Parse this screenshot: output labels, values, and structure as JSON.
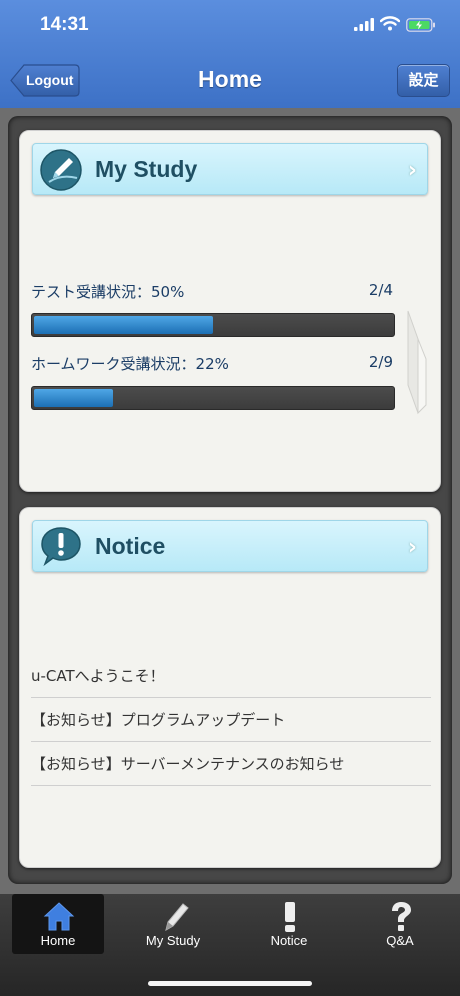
{
  "status_bar": {
    "time": "14:31"
  },
  "nav": {
    "title": "Home",
    "logout_label": "Logout",
    "settings_label": "設定"
  },
  "study_card": {
    "title": "My Study",
    "icon": "pencil-badge-icon",
    "progress": [
      {
        "label": "テスト受講状況：50%",
        "count": "2/4",
        "percent": 50
      },
      {
        "label": "ホームワーク受講状況：22%",
        "count": "2/9",
        "percent": 22
      }
    ]
  },
  "notice_card": {
    "title": "Notice",
    "icon": "exclamation-bubble-icon",
    "items": [
      "u-CATへようこそ！",
      "【お知らせ】プログラムアップデート",
      "【お知らせ】サーバーメンテナンスのお知らせ"
    ]
  },
  "tabbar": {
    "items": [
      {
        "label": "Home",
        "icon": "house-icon",
        "active": true
      },
      {
        "label": "My Study",
        "icon": "pencil-icon",
        "active": false
      },
      {
        "label": "Notice",
        "icon": "exclamation-icon",
        "active": false
      },
      {
        "label": "Q&A",
        "icon": "question-icon",
        "active": false
      }
    ]
  },
  "colors": {
    "header_blue": "#3d71c6",
    "progress_fill": "#1c6fb4",
    "card_header": "#b7e9f7"
  }
}
